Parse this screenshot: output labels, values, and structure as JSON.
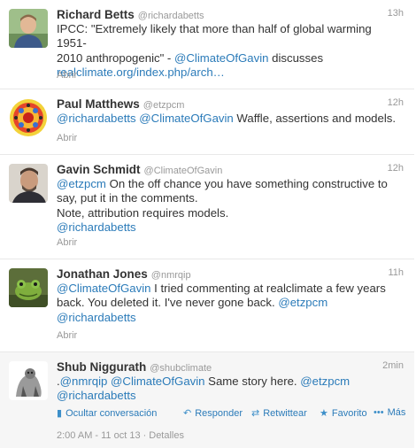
{
  "open_label": "Abrir",
  "tweets": [
    {
      "name": "Richard Betts",
      "handle": "@richardabetts",
      "time": "13h",
      "t1": "IPCC: \"Extremely likely that more than half of global warming 1951-",
      "t2a": "2010 anthropogenic\" - ",
      "t2link": "@ClimateOfGavin",
      "t2b": " discusses",
      "t3link": "realclimate.org/index.php/arch…"
    },
    {
      "name": "Paul Matthews",
      "handle": "@etzpcm",
      "time": "12h",
      "link1": "@richardabetts",
      "link2": "@ClimateOfGavin",
      "rest": " Waffle, assertions and models."
    },
    {
      "name": "Gavin Schmidt",
      "handle": "@ClimateOfGavin",
      "time": "12h",
      "link1": "@etzpcm",
      "l1": " On the off chance you have something constructive to",
      "l2": "say, put it in the comments.",
      "l3": "Note, attribution requires models.",
      "link2": "@richardabetts"
    },
    {
      "name": "Jonathan Jones",
      "handle": "@nmrqip",
      "time": "11h",
      "link1": "@ClimateOfGavin",
      "l1": " I tried commenting at realclimate a few years",
      "l2": "back. You deleted it. I've never gone back. ",
      "link2": "@etzpcm",
      "link3": "@richardabetts"
    },
    {
      "name": "Shub Niggurath",
      "handle": "@shubclimate",
      "time": "2min",
      "lead": ".",
      "link1": "@nmrqip",
      "link2": "@ClimateOfGavin",
      "mid": " Same story here. ",
      "link3": "@etzpcm",
      "link4": "@richardabetts",
      "actions": {
        "hide": "Ocultar conversación",
        "reply": "Responder",
        "retweet": "Retwittear",
        "favorite": "Favorito",
        "more": "Más"
      },
      "meta": {
        "datetime": "2:00 AM - 11 oct 13",
        "details": "Detalles"
      }
    }
  ]
}
